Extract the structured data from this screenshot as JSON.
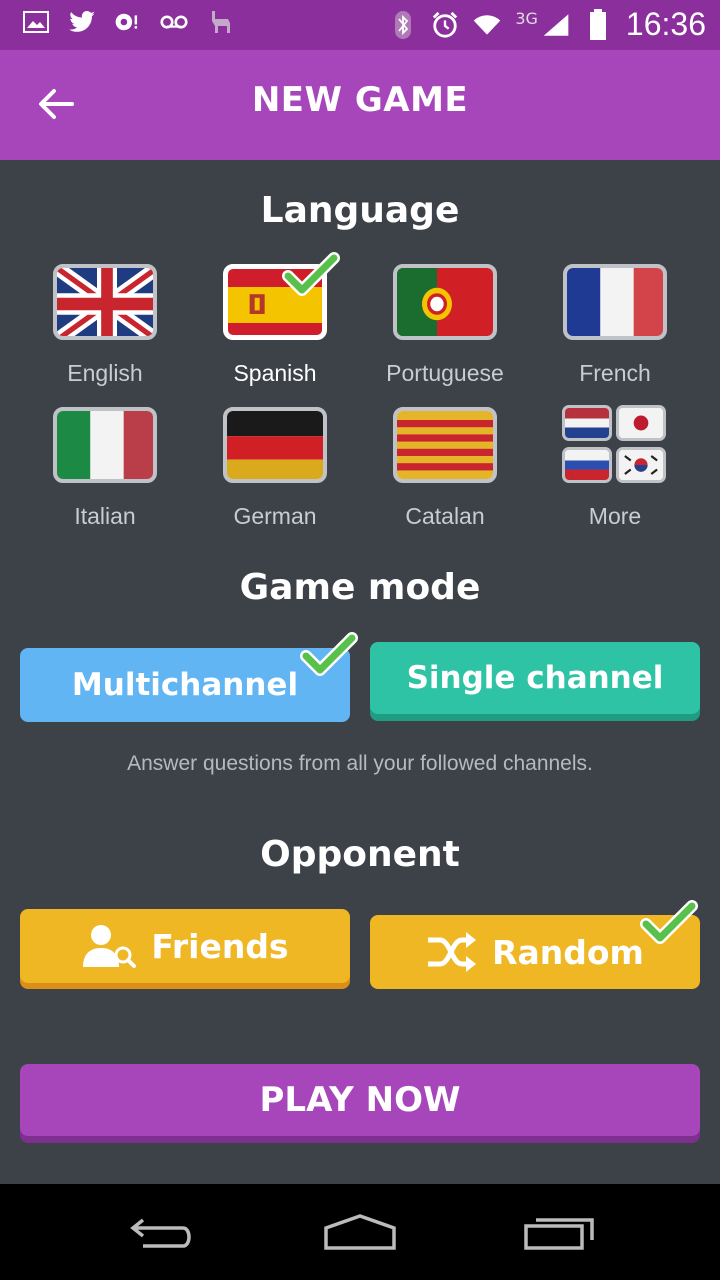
{
  "status_bar": {
    "time": "16:36",
    "network": "3G",
    "left_icons": [
      "image-icon",
      "twitter-icon",
      "sync-alert-icon",
      "voicemail-icon",
      "llama-icon"
    ],
    "right_icons": [
      "bluetooth-icon",
      "alarm-icon",
      "wifi-icon",
      "signal-icon",
      "battery-icon"
    ]
  },
  "app_bar": {
    "title": "NEW GAME",
    "back_icon": "arrow-left-icon"
  },
  "language": {
    "title": "Language",
    "selected": "Spanish",
    "items": [
      {
        "label": "English",
        "flag": "uk"
      },
      {
        "label": "Spanish",
        "flag": "es"
      },
      {
        "label": "Portuguese",
        "flag": "pt"
      },
      {
        "label": "French",
        "flag": "fr"
      },
      {
        "label": "Italian",
        "flag": "it"
      },
      {
        "label": "German",
        "flag": "de"
      },
      {
        "label": "Catalan",
        "flag": "cat"
      },
      {
        "label": "More",
        "flag": "more"
      }
    ]
  },
  "game_mode": {
    "title": "Game mode",
    "multichannel_label": "Multichannel",
    "single_channel_label": "Single channel",
    "selected": "Multichannel",
    "description": "Answer questions from all your followed channels."
  },
  "opponent": {
    "title": "Opponent",
    "friends_label": "Friends",
    "random_label": "Random",
    "selected": "Random"
  },
  "play_button": {
    "label": "PLAY NOW"
  },
  "colors": {
    "status_bar": "#8a2f9c",
    "app_bar": "#a646ba",
    "background": "#3d4148",
    "multichannel": "#60b5f2",
    "single_channel": "#2dc3a4",
    "opponent_buttons": "#f0b724",
    "check": "#59c14b"
  }
}
